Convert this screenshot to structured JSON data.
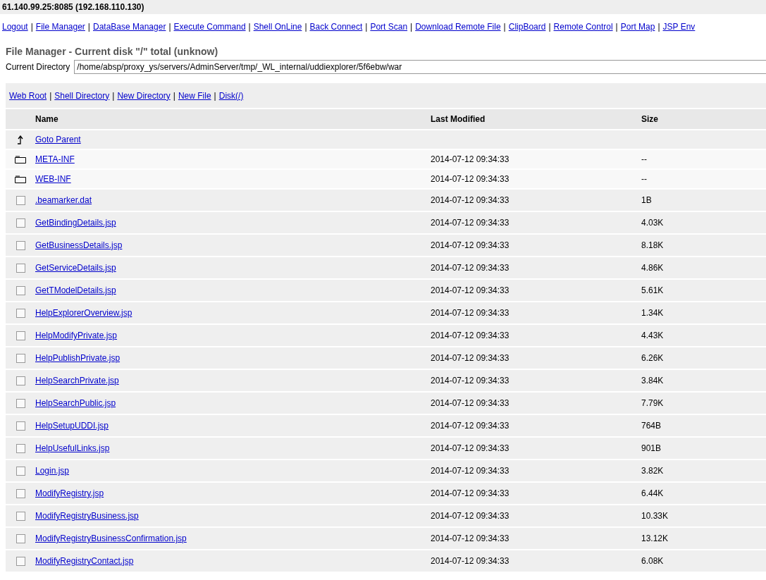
{
  "host": "61.140.99.25:8085 (192.168.110.130)",
  "nav": [
    {
      "label": "Logout"
    },
    {
      "separator": "|",
      "label": "File Manager"
    },
    {
      "separator": "|",
      "label": "DataBase Manager"
    },
    {
      "separator": "|",
      "label": "Execute Command"
    },
    {
      "separator": "|",
      "label": "Shell OnLine"
    },
    {
      "separator": "|",
      "label": "Back Connect"
    },
    {
      "separator": "|",
      "label": "Port Scan"
    },
    {
      "separator": "|",
      "label": "Download Remote File"
    },
    {
      "separator": "|",
      "label": "ClipBoard"
    },
    {
      "separator": "|",
      "label": "Remote Control"
    },
    {
      "separator": "|",
      "label": "Port Map"
    },
    {
      "separator": "|",
      "label": "JSP Env"
    }
  ],
  "heading": "File Manager - Current disk \"/\" total (unknow)",
  "directory": {
    "label": "Current Directory",
    "value": "/home/absp/proxy_ys/servers/AdminServer/tmp/_WL_internal/uddiexplorer/5f6ebw/war"
  },
  "toolbar": [
    {
      "label": "Web Root"
    },
    {
      "separator": "|",
      "label": "Shell Directory"
    },
    {
      "separator": "|",
      "label": "New Directory"
    },
    {
      "separator": "|",
      "label": "New File"
    },
    {
      "separator": "|",
      "label": "Disk(/)"
    }
  ],
  "table": {
    "columns": [
      "Name",
      "Last Modified",
      "Size"
    ],
    "rows": [
      {
        "kind": "parent",
        "name": "Goto Parent"
      },
      {
        "kind": "dir",
        "name": "META-INF",
        "modified": "2014-07-12 09:34:33",
        "size": "--"
      },
      {
        "kind": "dir",
        "name": "WEB-INF",
        "modified": "2014-07-12 09:34:33",
        "size": "--"
      },
      {
        "kind": "file",
        "checked": false,
        "name": ".beamarker.dat",
        "modified": "2014-07-12 09:34:33",
        "size": "1B"
      },
      {
        "kind": "file",
        "checked": false,
        "name": "GetBindingDetails.jsp",
        "modified": "2014-07-12 09:34:33",
        "size": "4.03K"
      },
      {
        "kind": "file",
        "checked": false,
        "name": "GetBusinessDetails.jsp",
        "modified": "2014-07-12 09:34:33",
        "size": "8.18K"
      },
      {
        "kind": "file",
        "checked": false,
        "name": "GetServiceDetails.jsp",
        "modified": "2014-07-12 09:34:33",
        "size": "4.86K"
      },
      {
        "kind": "file",
        "checked": false,
        "name": "GetTModelDetails.jsp",
        "modified": "2014-07-12 09:34:33",
        "size": "5.61K"
      },
      {
        "kind": "file",
        "checked": false,
        "name": "HelpExplorerOverview.jsp",
        "modified": "2014-07-12 09:34:33",
        "size": "1.34K"
      },
      {
        "kind": "file",
        "checked": false,
        "name": "HelpModifyPrivate.jsp",
        "modified": "2014-07-12 09:34:33",
        "size": "4.43K"
      },
      {
        "kind": "file",
        "checked": false,
        "name": "HelpPublishPrivate.jsp",
        "modified": "2014-07-12 09:34:33",
        "size": "6.26K"
      },
      {
        "kind": "file",
        "checked": false,
        "name": "HelpSearchPrivate.jsp",
        "modified": "2014-07-12 09:34:33",
        "size": "3.84K"
      },
      {
        "kind": "file",
        "checked": false,
        "name": "HelpSearchPublic.jsp",
        "modified": "2014-07-12 09:34:33",
        "size": "7.79K"
      },
      {
        "kind": "file",
        "checked": false,
        "name": "HelpSetupUDDI.jsp",
        "modified": "2014-07-12 09:34:33",
        "size": "764B"
      },
      {
        "kind": "file",
        "checked": false,
        "name": "HelpUsefulLinks.jsp",
        "modified": "2014-07-12 09:34:33",
        "size": "901B"
      },
      {
        "kind": "file",
        "checked": false,
        "name": "Login.jsp",
        "modified": "2014-07-12 09:34:33",
        "size": "3.82K"
      },
      {
        "kind": "file",
        "checked": false,
        "name": "ModifyRegistry.jsp",
        "modified": "2014-07-12 09:34:33",
        "size": "6.44K"
      },
      {
        "kind": "file",
        "checked": false,
        "name": "ModifyRegistryBusiness.jsp",
        "modified": "2014-07-12 09:34:33",
        "size": "10.33K"
      },
      {
        "kind": "file",
        "checked": false,
        "name": "ModifyRegistryBusinessConfirmation.jsp",
        "modified": "2014-07-12 09:34:33",
        "size": "13.12K"
      },
      {
        "kind": "file",
        "checked": false,
        "name": "ModifyRegistryContact.jsp",
        "modified": "2014-07-12 09:34:33",
        "size": "6.08K"
      }
    ]
  }
}
